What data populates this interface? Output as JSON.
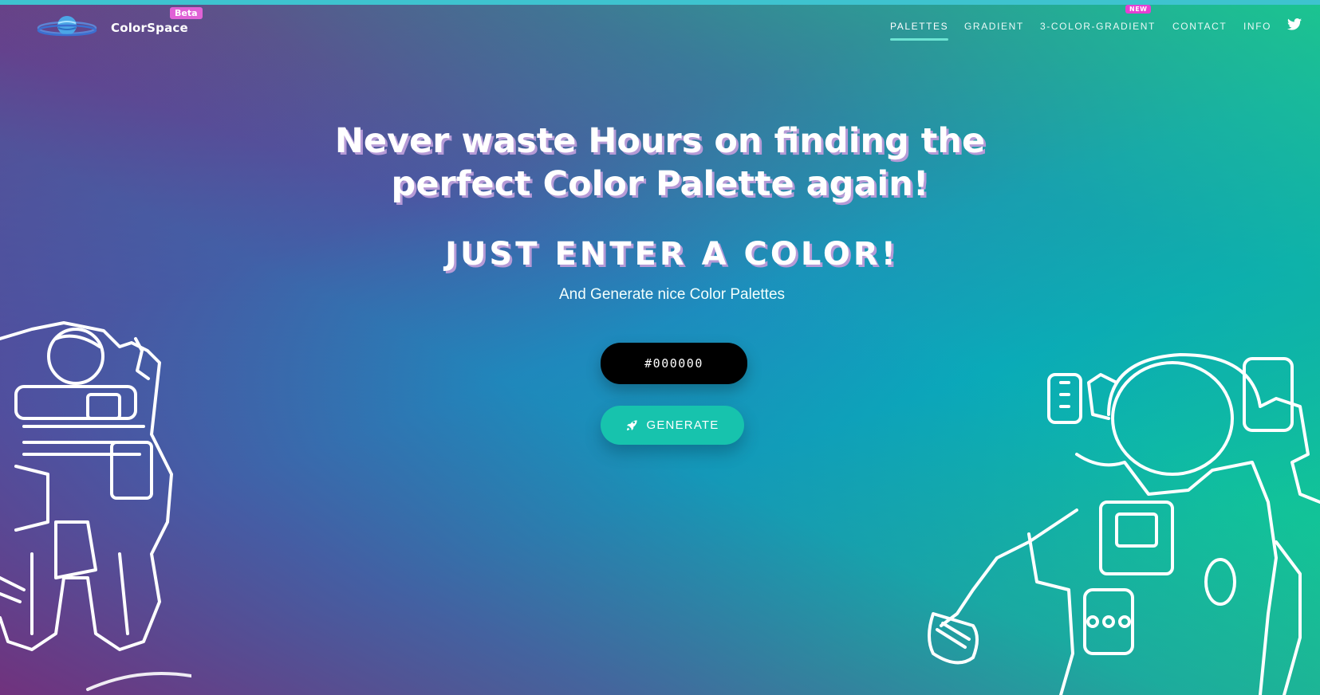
{
  "header": {
    "brand": "ColorSpace",
    "badge": "Beta",
    "nav": [
      {
        "label": "PALETTES",
        "active": true
      },
      {
        "label": "GRADIENT",
        "active": false
      },
      {
        "label": "3-COLOR-GRADIENT",
        "active": false,
        "badge": "NEW"
      },
      {
        "label": "CONTACT",
        "active": false
      },
      {
        "label": "INFO",
        "active": false
      }
    ],
    "social_icon": "twitter-icon"
  },
  "hero": {
    "headline_line1": "Never waste Hours on finding the",
    "headline_line2": "perfect Color Palette again!",
    "subhead": "JUST ENTER A COLOR!",
    "tagline": "And Generate nice Color Palettes",
    "color_input_value": "#000000",
    "generate_label": "GENERATE",
    "generate_icon": "rocket-icon"
  },
  "colors": {
    "gradient_top_right": "#19c98c",
    "gradient_middle": "#09a9bb",
    "gradient_bottom_left": "#7a2f7e",
    "button_teal": "#17c3ad",
    "beta_badge": "#e062d6",
    "new_badge": "#e63fd3",
    "input_bg": "#000000"
  },
  "decorations": [
    "astronaut-left-illustration",
    "astronaut-right-illustration",
    "planet-logo-icon"
  ]
}
